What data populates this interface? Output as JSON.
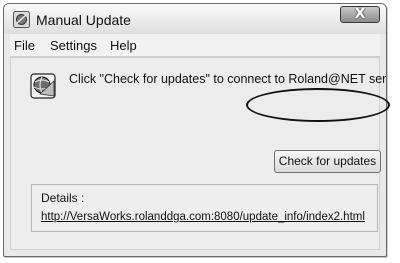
{
  "window": {
    "title": "Manual Update",
    "close_glyph": "X",
    "icon": "app-icon",
    "close_icon": "close-icon"
  },
  "menu": {
    "items": [
      "File",
      "Settings",
      "Help"
    ]
  },
  "main": {
    "icon": "globe-icon",
    "message": "Click \"Check for updates\" to connect to Roland@NET server.",
    "check_button_label": "Check for updates"
  },
  "details": {
    "label": "Details :",
    "link": "http://VersaWorks.rolanddga.com:8080/update_info/index2.html"
  }
}
